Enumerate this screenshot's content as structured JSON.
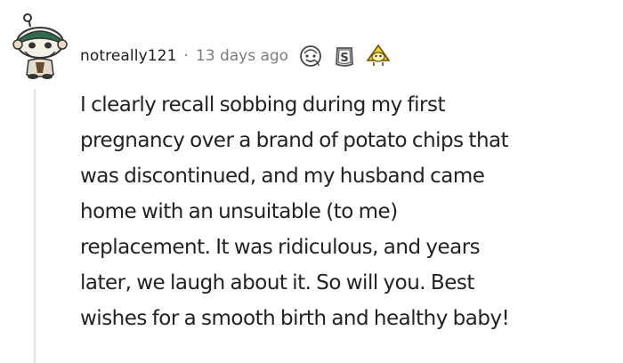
{
  "comment": {
    "username": "notreally121",
    "separator": "·",
    "timestamp": "13 days ago",
    "awards": [
      {
        "icon": "wholesome-face-award-icon"
      },
      {
        "icon": "silver-award-icon"
      },
      {
        "icon": "helpful-award-icon"
      }
    ],
    "body_lines": [
      "I clearly recall sobbing during my first",
      "pregnancy over a brand of potato chips that",
      "was discontinued, and my husband came",
      "home with an unsuitable (to me)",
      "replacement. It was ridiculous, and years",
      "later, we laugh about it. So will you. Best",
      "wishes for a smooth birth and healthy baby!"
    ]
  },
  "colors": {
    "username": "#1c1c1c",
    "meta": "#7c7c7c",
    "body": "#222222",
    "thread_line": "#e2e2e2",
    "helpful_award": "#f5cf3a"
  }
}
